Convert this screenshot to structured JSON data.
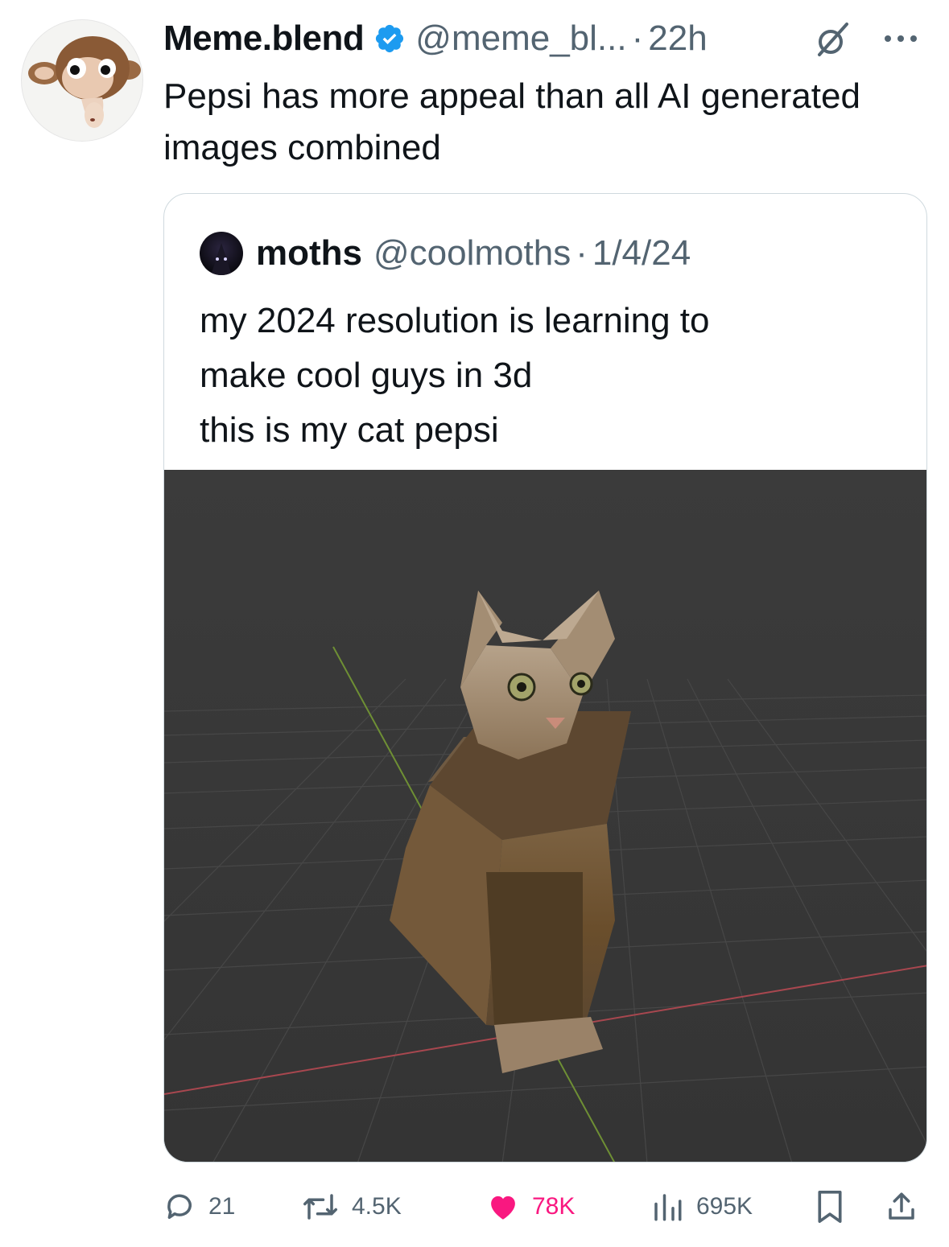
{
  "tweet": {
    "display_name": "Meme.blend",
    "handle": "@meme_bl...",
    "separator": "·",
    "time": "22h",
    "text": "Pepsi has more appeal than all AI generated images combined"
  },
  "quoted_tweet": {
    "display_name": "moths",
    "handle": "@coolmoths",
    "separator": "·",
    "date": "1/4/24",
    "text_lines": [
      "my 2024 resolution is learning to",
      "make cool guys in 3d",
      "this is my cat pepsi"
    ]
  },
  "actions": {
    "replies": "21",
    "reposts": "4.5K",
    "likes": "78K",
    "views": "695K"
  },
  "colors": {
    "verified": "#1d9bf0",
    "like": "#f91880",
    "muted": "#536471",
    "viewport_bg": "#3a3a3a"
  },
  "icons": [
    "verified-badge-icon",
    "grok-icon",
    "more-icon",
    "reply-icon",
    "repost-icon",
    "like-icon",
    "views-icon",
    "bookmark-icon",
    "share-icon"
  ]
}
